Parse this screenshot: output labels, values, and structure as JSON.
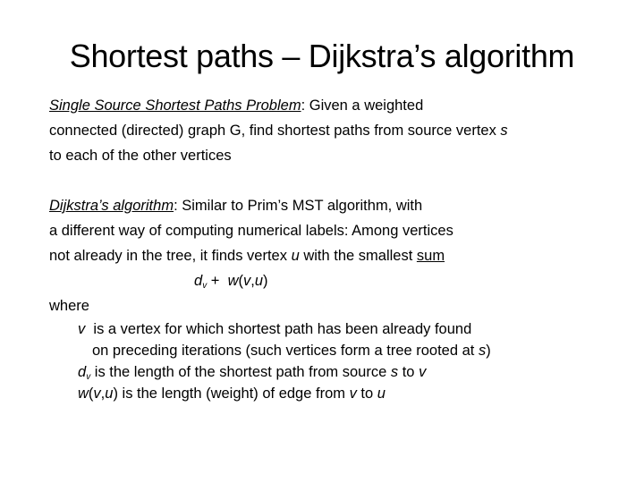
{
  "slide": {
    "title": "Shortest paths – Dijkstra’s algorithm",
    "problem": {
      "term": "Single Source Shortest Paths Problem",
      "text1": ": Given a weighted",
      "line2_a": "connected (directed) graph G, find shortest paths from source vertex ",
      "line2_var": "s",
      "line3": "to each of the other vertices"
    },
    "algorithm": {
      "term": "Dijkstra’s algorithm",
      "text1": ": Similar to Prim’s MST algorithm, with",
      "line2": "a different way of computing numerical labels: Among vertices",
      "line3_a": "not already in the tree, it finds vertex ",
      "line3_var": "u",
      "line3_b": " with the smallest ",
      "line3_sum": "sum"
    },
    "formula": {
      "d": "d",
      "sub": "v",
      "plus": " +  ",
      "w": "w",
      "args_open": "(",
      "v": "v",
      "comma": ",",
      "u": "u",
      "args_close": ")"
    },
    "where": {
      "label": "where",
      "item1_var": "v",
      "item1_text": "  is a vertex for which shortest path has been already found",
      "item1_cont_a": "on preceding iterations (such vertices form a tree rooted at ",
      "item1_cont_var": "s",
      "item1_cont_b": ")",
      "item2_d": "d",
      "item2_sub": "v",
      "item2_text_a": " is the length of the shortest path from source ",
      "item2_s": "s",
      "item2_text_b": " to ",
      "item2_v": "v",
      "item3_w": "w",
      "item3_open": "(",
      "item3_v": "v",
      "item3_comma": ",",
      "item3_u": "u",
      "item3_text_a": ") is the length (weight) of edge from ",
      "item3_v2": "v",
      "item3_to": " to ",
      "item3_u2": "u"
    }
  }
}
